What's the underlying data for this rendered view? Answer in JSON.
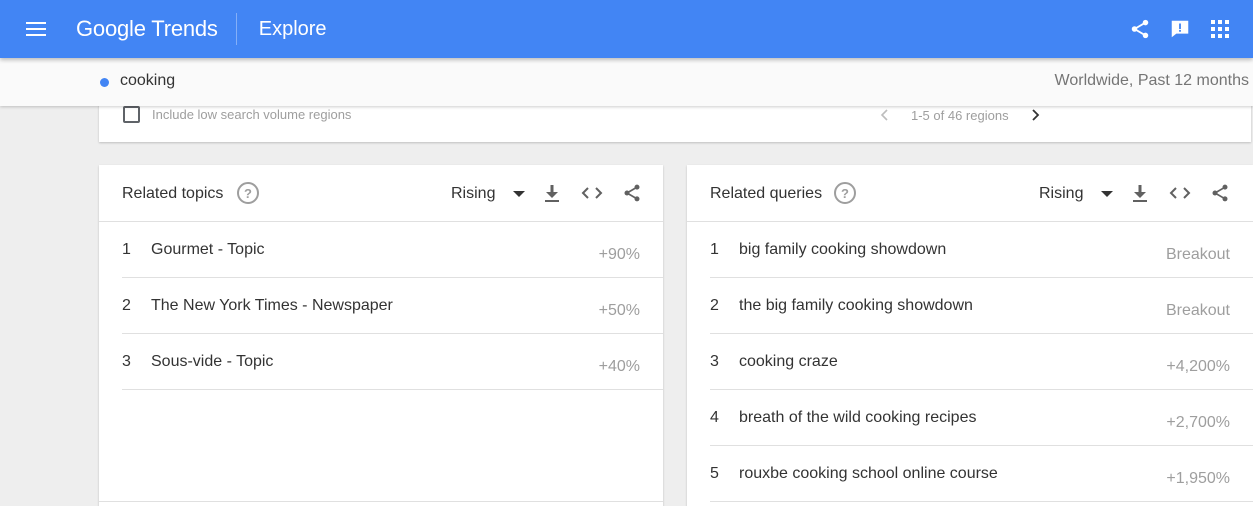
{
  "header": {
    "logo_google": "Google",
    "logo_trends": "Trends",
    "section": "Explore",
    "icons": [
      "share-icon",
      "feedback-icon",
      "apps-icon"
    ],
    "colors": {
      "bar": "#4285f4",
      "term_dot": "#4285f4"
    }
  },
  "term_bar": {
    "term": "cooking",
    "scope": "Worldwide, Past 12 months"
  },
  "regions": {
    "checkbox_label": "Include low search volume regions",
    "pager_text": "1-5 of 46 regions"
  },
  "related_topics": {
    "title": "Related topics",
    "help": "?",
    "filter": "Rising",
    "rows": [
      {
        "rank": "1",
        "label": "Gourmet - Topic",
        "value": "+90%"
      },
      {
        "rank": "2",
        "label": "The New York Times - Newspaper",
        "value": "+50%"
      },
      {
        "rank": "3",
        "label": "Sous-vide - Topic",
        "value": "+40%"
      }
    ]
  },
  "related_queries": {
    "title": "Related queries",
    "help": "?",
    "filter": "Rising",
    "rows": [
      {
        "rank": "1",
        "label": "big family cooking showdown",
        "value": "Breakout"
      },
      {
        "rank": "2",
        "label": "the big family cooking showdown",
        "value": "Breakout"
      },
      {
        "rank": "3",
        "label": "cooking craze",
        "value": "+4,200%"
      },
      {
        "rank": "4",
        "label": "breath of the wild cooking recipes",
        "value": "+2,700%"
      },
      {
        "rank": "5",
        "label": "rouxbe cooking school online course",
        "value": "+1,950%"
      }
    ]
  }
}
